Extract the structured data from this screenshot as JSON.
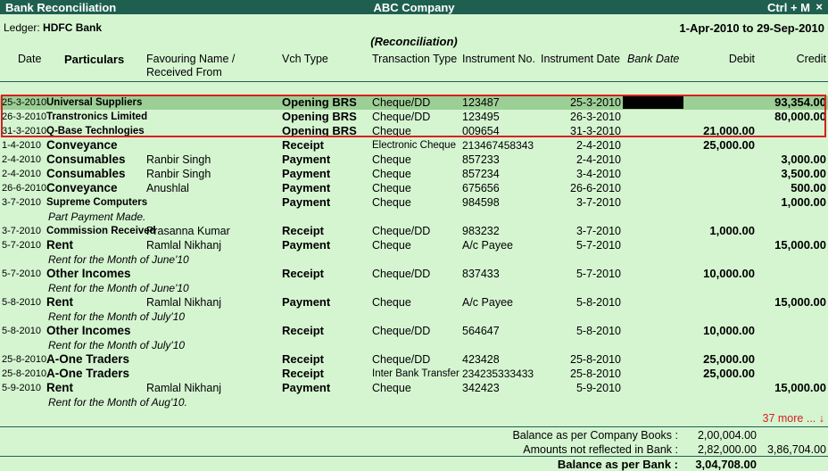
{
  "title_bar": {
    "title": "Bank Reconciliation",
    "company": "ABC Company",
    "shortcut": "Ctrl + M",
    "close": "×"
  },
  "ledger": {
    "label": "Ledger:",
    "name": "HDFC Bank"
  },
  "period": "1-Apr-2010 to 29-Sep-2010",
  "subtitle": "(Reconciliation)",
  "columns": {
    "date": "Date",
    "particulars": "Particulars",
    "favouring_1": "Favouring Name /",
    "favouring_2": "Received From",
    "vch_type": "Vch Type",
    "txn_type": "Transaction Type",
    "inst_no": "Instrument No.",
    "inst_date": "Instrument Date",
    "bank_date": "Bank Date",
    "debit": "Debit",
    "credit": "Credit"
  },
  "rows": [
    {
      "date": "25-3-2010",
      "particulars": "Universal Suppliers",
      "fav": "",
      "vch": "Opening BRS",
      "txn": "Cheque/DD",
      "inst_no": "123487",
      "inst_date": "25-3-2010",
      "debit": "",
      "credit": "93,354.00",
      "narration": "",
      "small": true
    },
    {
      "date": "26-3-2010",
      "particulars": "Transtronics Limited",
      "fav": "",
      "vch": "Opening BRS",
      "txn": "Cheque/DD",
      "inst_no": "123495",
      "inst_date": "26-3-2010",
      "debit": "",
      "credit": "80,000.00",
      "narration": "",
      "small": true
    },
    {
      "date": "31-3-2010",
      "particulars": "Q-Base Technlogies",
      "fav": "",
      "vch": "Opening BRS",
      "txn": "Cheque",
      "inst_no": "009654",
      "inst_date": "31-3-2010",
      "debit": "21,000.00",
      "credit": "",
      "narration": "",
      "small": true
    },
    {
      "date": "1-4-2010",
      "particulars": "Conveyance",
      "fav": "",
      "vch": "Receipt",
      "txn": "Electronic Cheque",
      "inst_no": "213467458343",
      "inst_date": "2-4-2010",
      "debit": "25,000.00",
      "credit": "",
      "narration": "",
      "small": false
    },
    {
      "date": "2-4-2010",
      "particulars": "Consumables",
      "fav": "Ranbir Singh",
      "vch": "Payment",
      "txn": "Cheque",
      "inst_no": "857233",
      "inst_date": "2-4-2010",
      "debit": "",
      "credit": "3,000.00",
      "narration": "",
      "small": false
    },
    {
      "date": "2-4-2010",
      "particulars": "Consumables",
      "fav": "Ranbir Singh",
      "vch": "Payment",
      "txn": "Cheque",
      "inst_no": "857234",
      "inst_date": "3-4-2010",
      "debit": "",
      "credit": "3,500.00",
      "narration": "",
      "small": false
    },
    {
      "date": "26-6-2010",
      "particulars": "Conveyance",
      "fav": "Anushlal",
      "vch": "Payment",
      "txn": "Cheque",
      "inst_no": "675656",
      "inst_date": "26-6-2010",
      "debit": "",
      "credit": "500.00",
      "narration": "",
      "small": false
    },
    {
      "date": "3-7-2010",
      "particulars": "Supreme Computers",
      "fav": "",
      "vch": "Payment",
      "txn": "Cheque",
      "inst_no": "984598",
      "inst_date": "3-7-2010",
      "debit": "",
      "credit": "1,000.00",
      "narration": "Part Payment Made.",
      "small": true
    },
    {
      "date": "3-7-2010",
      "particulars": "Commission Received",
      "fav": "Prasanna Kumar",
      "vch": "Receipt",
      "txn": "Cheque/DD",
      "inst_no": "983232",
      "inst_date": "3-7-2010",
      "debit": "1,000.00",
      "credit": "",
      "narration": "",
      "small": true
    },
    {
      "date": "5-7-2010",
      "particulars": "Rent",
      "fav": "Ramlal Nikhanj",
      "vch": "Payment",
      "txn": "Cheque",
      "inst_no": "A/c Payee",
      "inst_date": "5-7-2010",
      "debit": "",
      "credit": "15,000.00",
      "narration": "Rent for the Month of June'10",
      "small": false
    },
    {
      "date": "5-7-2010",
      "particulars": "Other Incomes",
      "fav": "",
      "vch": "Receipt",
      "txn": "Cheque/DD",
      "inst_no": "837433",
      "inst_date": "5-7-2010",
      "debit": "10,000.00",
      "credit": "",
      "narration": "Rent for the Month of June'10",
      "small": false
    },
    {
      "date": "5-8-2010",
      "particulars": "Rent",
      "fav": "Ramlal Nikhanj",
      "vch": "Payment",
      "txn": "Cheque",
      "inst_no": "A/c Payee",
      "inst_date": "5-8-2010",
      "debit": "",
      "credit": "15,000.00",
      "narration": "Rent for the Month of July'10",
      "small": false
    },
    {
      "date": "5-8-2010",
      "particulars": "Other Incomes",
      "fav": "",
      "vch": "Receipt",
      "txn": "Cheque/DD",
      "inst_no": "564647",
      "inst_date": "5-8-2010",
      "debit": "10,000.00",
      "credit": "",
      "narration": "Rent for the Month of July'10",
      "small": false
    },
    {
      "date": "25-8-2010",
      "particulars": "A-One Traders",
      "fav": "",
      "vch": "Receipt",
      "txn": "Cheque/DD",
      "inst_no": "423428",
      "inst_date": "25-8-2010",
      "debit": "25,000.00",
      "credit": "",
      "narration": "",
      "small": false
    },
    {
      "date": "25-8-2010",
      "particulars": "A-One Traders",
      "fav": "",
      "vch": "Receipt",
      "txn": "Inter Bank Transfer",
      "inst_no": "234235333433",
      "inst_date": "25-8-2010",
      "debit": "25,000.00",
      "credit": "",
      "narration": "",
      "small": false
    },
    {
      "date": "5-9-2010",
      "particulars": "Rent",
      "fav": "Ramlal Nikhanj",
      "vch": "Payment",
      "txn": "Cheque",
      "inst_no": "342423",
      "inst_date": "5-9-2010",
      "debit": "",
      "credit": "15,000.00",
      "narration": "Rent for the Month of Aug'10.",
      "small": false
    }
  ],
  "more": "37 more ... ↓",
  "footer": {
    "company_books_label": "Balance as per Company Books :",
    "company_books_value": "2,00,004.00",
    "not_reflected_label": "Amounts not reflected in Bank :",
    "not_reflected_debit": "2,82,000.00",
    "not_reflected_credit": "3,86,704.00",
    "bank_label": "Balance as per Bank :",
    "bank_value": "3,04,708.00"
  }
}
